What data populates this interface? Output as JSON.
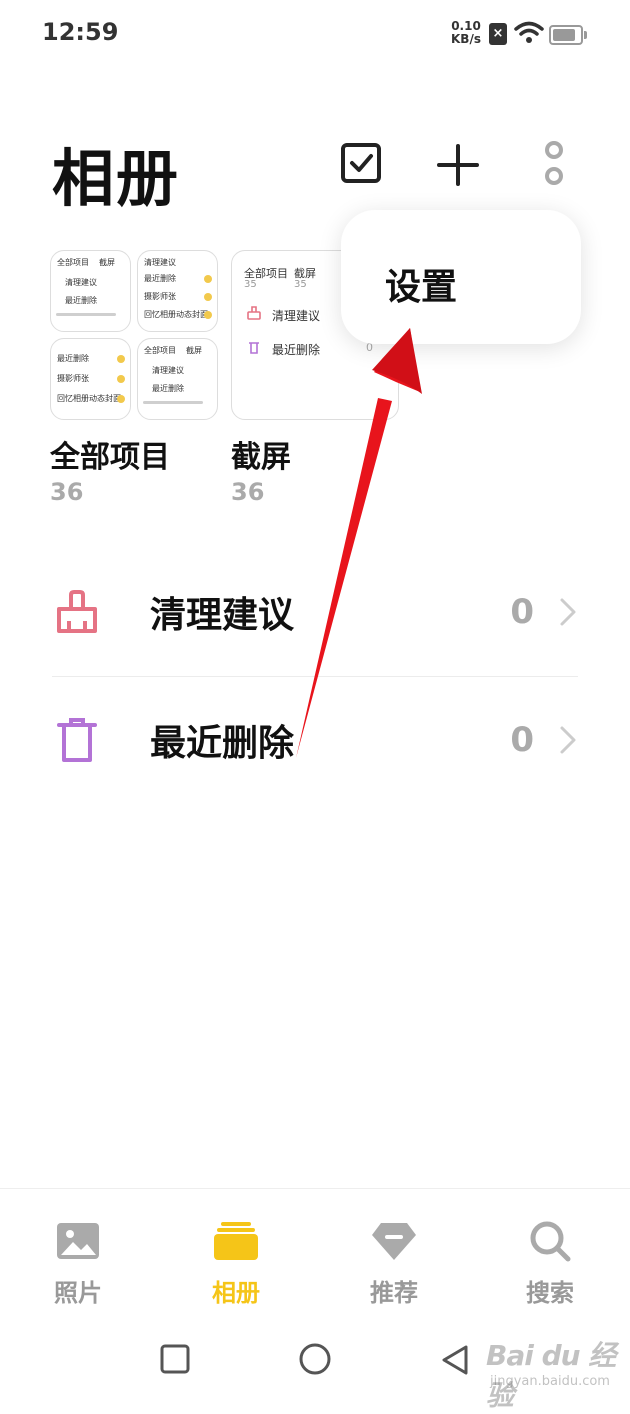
{
  "status_bar": {
    "time": "12:59",
    "net_speed_value": "0.10",
    "net_speed_unit": "KB/s",
    "sim_icon": "sim-disabled-icon",
    "wifi_icon": "wifi-icon",
    "battery_icon": "battery-icon"
  },
  "header": {
    "title": "相册",
    "actions": [
      "select-icon",
      "add-icon",
      "more-icon"
    ]
  },
  "popup_menu": {
    "items": [
      {
        "label": "设置"
      }
    ]
  },
  "albums": [
    {
      "name": "全部项目",
      "count": "36"
    },
    {
      "name": "截屏",
      "count": "36"
    }
  ],
  "thumb_text": {
    "all_items": "全部项目",
    "screenshot": "截屏",
    "cleanup": "清理建议",
    "recently_deleted": "最近删除",
    "photography": "摄影师张",
    "memories": "回忆相册动态封面",
    "count_35": "35",
    "zero": "0"
  },
  "list": [
    {
      "label": "清理建议",
      "count": "0",
      "icon": "broom-icon",
      "color": "#e57384"
    },
    {
      "label": "最近删除",
      "count": "0",
      "icon": "trash-icon",
      "color": "#b373d6"
    }
  ],
  "bottom_nav": [
    {
      "label": "照片",
      "icon": "image-icon",
      "active": false
    },
    {
      "label": "相册",
      "icon": "album-icon",
      "active": true
    },
    {
      "label": "推荐",
      "icon": "tag-icon",
      "active": false
    },
    {
      "label": "搜索",
      "icon": "search-icon",
      "active": false
    }
  ],
  "colors": {
    "accent": "#f5c518",
    "annotation_arrow": "#e8141c"
  },
  "watermark": {
    "main": "Bai du 经验",
    "sub": "jingyan.baidu.com"
  }
}
